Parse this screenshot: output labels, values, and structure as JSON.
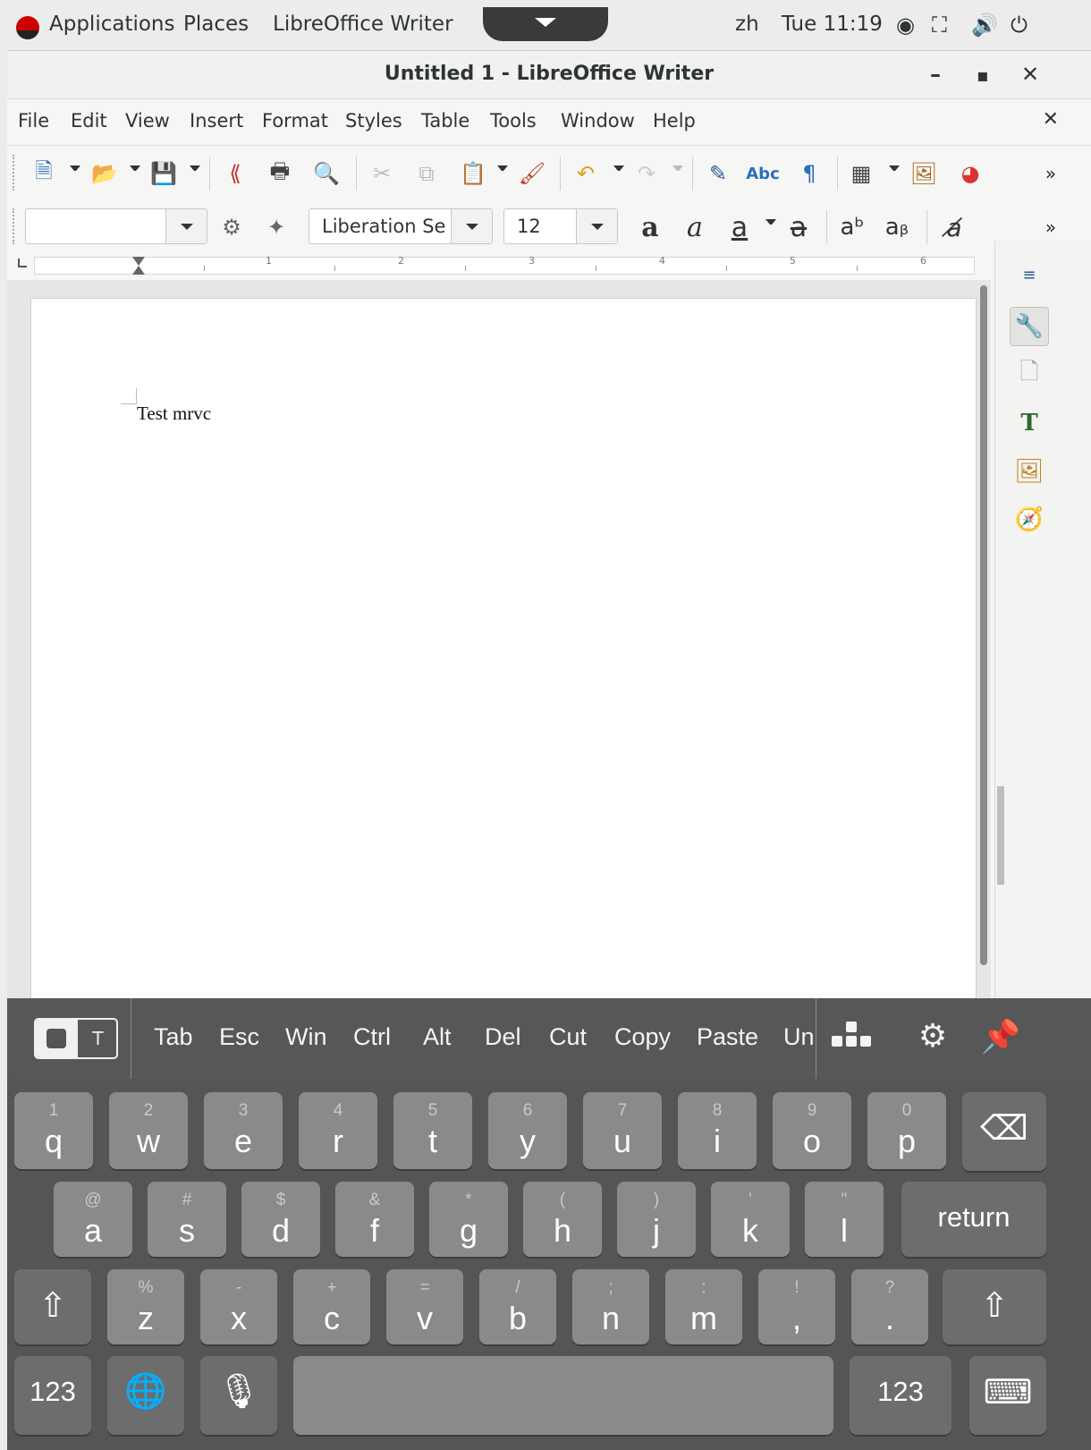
{
  "topbar": {
    "applications": "Applications",
    "places": "Places",
    "app_name": "LibreOffice Writer",
    "lang": "zh",
    "clock": "Tue 11:19"
  },
  "window": {
    "title": "Untitled 1 - LibreOffice Writer",
    "minimize": "–",
    "maximize": "▪",
    "close": "✕"
  },
  "menubar": {
    "items": [
      "File",
      "Edit",
      "View",
      "Insert",
      "Format",
      "Styles",
      "Table",
      "Tools",
      "Window",
      "Help"
    ],
    "close_doc": "✕"
  },
  "formatting": {
    "paragraph_style": "",
    "font_name": "Liberation Se",
    "font_size": "12"
  },
  "ruler": {
    "numbers": [
      "1",
      "2",
      "3",
      "4",
      "5",
      "6"
    ]
  },
  "document": {
    "text": "Test mrvc"
  },
  "keyboard": {
    "mode_text": "T",
    "shortcuts": [
      "Tab",
      "Esc",
      "Win",
      "Ctrl",
      "Alt",
      "Del",
      "Cut",
      "Copy",
      "Paste",
      "Un"
    ],
    "row1": [
      {
        "main": "q",
        "alt": "1"
      },
      {
        "main": "w",
        "alt": "2"
      },
      {
        "main": "e",
        "alt": "3"
      },
      {
        "main": "r",
        "alt": "4"
      },
      {
        "main": "t",
        "alt": "5"
      },
      {
        "main": "y",
        "alt": "6"
      },
      {
        "main": "u",
        "alt": "7"
      },
      {
        "main": "i",
        "alt": "8"
      },
      {
        "main": "o",
        "alt": "9"
      },
      {
        "main": "p",
        "alt": "0"
      }
    ],
    "row2": [
      {
        "main": "a",
        "alt": "@"
      },
      {
        "main": "s",
        "alt": "#"
      },
      {
        "main": "d",
        "alt": "$"
      },
      {
        "main": "f",
        "alt": "&"
      },
      {
        "main": "g",
        "alt": "*"
      },
      {
        "main": "h",
        "alt": "("
      },
      {
        "main": "j",
        "alt": ")"
      },
      {
        "main": "k",
        "alt": "'"
      },
      {
        "main": "l",
        "alt": "\""
      }
    ],
    "return_label": "return",
    "row3": [
      {
        "main": "z",
        "alt": "%"
      },
      {
        "main": "x",
        "alt": "-"
      },
      {
        "main": "c",
        "alt": "+"
      },
      {
        "main": "v",
        "alt": "="
      },
      {
        "main": "b",
        "alt": "/"
      },
      {
        "main": "n",
        "alt": ";"
      },
      {
        "main": "m",
        "alt": ":"
      },
      {
        "main": ",",
        "alt": "!"
      },
      {
        "main": ".",
        "alt": "?"
      }
    ],
    "num_left": "123",
    "num_right": "123"
  }
}
